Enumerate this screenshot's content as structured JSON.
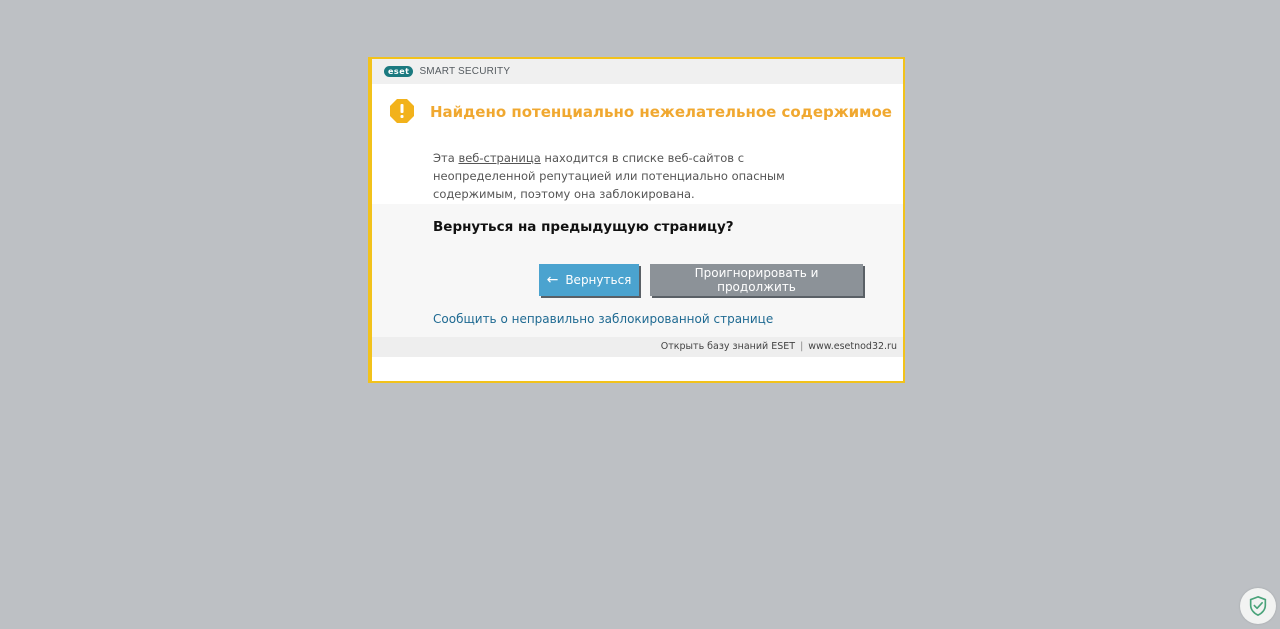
{
  "titlebar": {
    "logo_text": "eset",
    "product_name": "SMART SECURITY"
  },
  "warning": {
    "icon": "warning-octagon-icon",
    "title": "Найдено потенциально нежелательное содержимое",
    "description_prefix": "Эта ",
    "description_link": "веб-страница",
    "description_suffix": " находится в списке веб-сайтов с неопределенной репутацией или потенциально опасным содержимым, поэтому она заблокирована."
  },
  "prompt": {
    "question": "Вернуться на предыдущую страницу?",
    "back_button": "Вернуться",
    "ignore_button": "Проигнорировать и продолжить",
    "report_link": "Сообщить о неправильно заблокированной странице"
  },
  "footer": {
    "knowledge_base": "Открыть базу знаний ESET",
    "separator": "|",
    "site": "www.esetnod32.ru"
  },
  "colors": {
    "accent_border": "#f2c21b",
    "warning_title": "#f0a830",
    "back_button": "#4ba3cf",
    "ignore_button": "#8c9298",
    "link": "#1f6a92",
    "page_bg": "#bdc0c4"
  },
  "corner_badge": {
    "icon": "shield-check-icon"
  }
}
